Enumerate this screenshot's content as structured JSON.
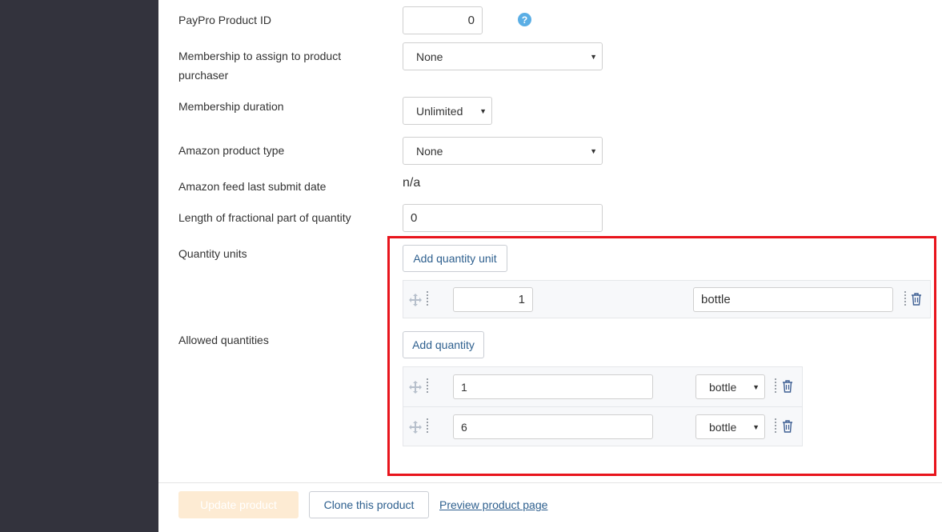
{
  "form": {
    "paypro_label": "PayPro Product ID",
    "paypro_value": "0",
    "membership_label": "Membership to assign to product purchaser",
    "membership_label_line1": "Membership to assign to product",
    "membership_label_line2": "purchaser",
    "membership_value": "None",
    "duration_label": "Membership duration",
    "duration_value": "Unlimited",
    "amazon_type_label": "Amazon product type",
    "amazon_type_value": "None",
    "amazon_date_label": "Amazon feed last submit date",
    "amazon_date_value": "n/a",
    "fraction_label": "Length of fractional part of quantity",
    "fraction_value": "0",
    "quantity_units_label": "Quantity units",
    "add_unit_label": "Add quantity unit",
    "units": [
      {
        "amount": "1",
        "name": "bottle"
      }
    ],
    "allowed_quantities_label": "Allowed quantities",
    "add_quantity_label": "Add quantity",
    "quantities": [
      {
        "amount": "1",
        "unit": "bottle"
      },
      {
        "amount": "6",
        "unit": "bottle"
      }
    ]
  },
  "footer": {
    "update_label": "Update product",
    "clone_label": "Clone this product",
    "preview_label": "Preview product page"
  },
  "icons": {
    "help": "question-circle-icon",
    "drag": "move-arrows-icon",
    "delete": "trash-icon",
    "dropdown": "caret-down-icon"
  },
  "colors": {
    "sidebar": "#33333d",
    "accent_link": "#2d5f8e",
    "highlight_border": "#e8141c",
    "help_icon": "#5aaee5",
    "disabled_button": "#fdebd3"
  }
}
